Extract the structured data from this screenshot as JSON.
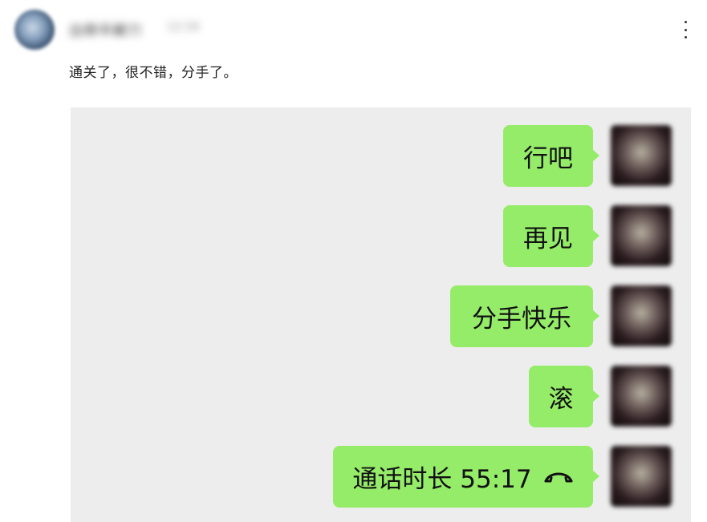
{
  "post": {
    "username": "白昼手握刀",
    "time": "12:34",
    "text": "通关了，很不错，分手了。"
  },
  "chat": {
    "messages": [
      {
        "text": "行吧"
      },
      {
        "text": "再见"
      },
      {
        "text": "分手快乐"
      },
      {
        "text": "滚"
      },
      {
        "text": "通话时长 55:17",
        "icon": "hang-up-phone-icon"
      }
    ]
  },
  "colors": {
    "bubble": "#95ec69",
    "chat_background": "#ededed"
  }
}
